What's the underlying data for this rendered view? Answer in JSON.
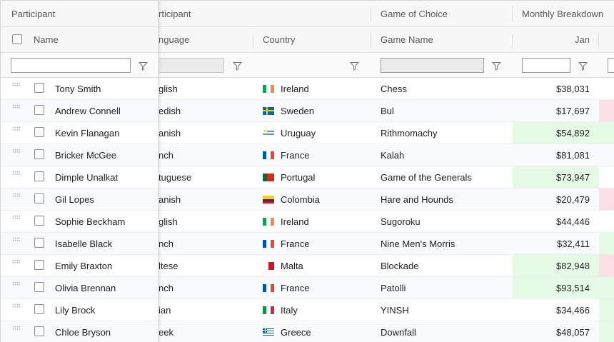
{
  "header_groups": {
    "participant": "Participant",
    "participant_scrolled": "rticipant",
    "game_of_choice": "Game of Choice",
    "monthly_breakdown": "Monthly Breakdown"
  },
  "columns": {
    "name": "Name",
    "language": "nguage",
    "country": "Country",
    "game_name": "Game Name",
    "jan": "Jan"
  },
  "rows": [
    {
      "name": "Tony Smith",
      "language": "glish",
      "country": "Ireland",
      "flag": "ireland-flag-icon",
      "game": "Chess",
      "jan": "$38,031",
      "jan_hl": "",
      "next_hl": ""
    },
    {
      "name": "Andrew Connell",
      "language": "edish",
      "country": "Sweden",
      "flag": "sweden-flag-icon",
      "game": "Bul",
      "jan": "$17,697",
      "jan_hl": "",
      "next_hl": "pink"
    },
    {
      "name": "Kevin Flanagan",
      "language": "anish",
      "country": "Uruguay",
      "flag": "uruguay-flag-icon",
      "game": "Rithmomachy",
      "jan": "$54,892",
      "jan_hl": "green",
      "next_hl": "green"
    },
    {
      "name": "Bricker McGee",
      "language": "nch",
      "country": "France",
      "flag": "france-flag-icon",
      "game": "Kalah",
      "jan": "$81,081",
      "jan_hl": "",
      "next_hl": ""
    },
    {
      "name": "Dimple Unalkat",
      "language": "tuguese",
      "country": "Portugal",
      "flag": "portugal-flag-icon",
      "game": "Game of the Generals",
      "jan": "$73,947",
      "jan_hl": "green",
      "next_hl": ""
    },
    {
      "name": "Gil Lopes",
      "language": "anish",
      "country": "Colombia",
      "flag": "colombia-flag-icon",
      "game": "Hare and Hounds",
      "jan": "$20,479",
      "jan_hl": "",
      "next_hl": "pink"
    },
    {
      "name": "Sophie Beckham",
      "language": "glish",
      "country": "Ireland",
      "flag": "ireland-flag-icon",
      "game": "Sugoroku",
      "jan": "$44,446",
      "jan_hl": "",
      "next_hl": ""
    },
    {
      "name": "Isabelle Black",
      "language": "nch",
      "country": "France",
      "flag": "france-flag-icon",
      "game": "Nine Men's Morris",
      "jan": "$32,411",
      "jan_hl": "",
      "next_hl": "green"
    },
    {
      "name": "Emily Braxton",
      "language": "ltese",
      "country": "Malta",
      "flag": "malta-flag-icon",
      "game": "Blockade",
      "jan": "$82,948",
      "jan_hl": "green",
      "next_hl": "pink"
    },
    {
      "name": "Olivia Brennan",
      "language": "nch",
      "country": "France",
      "flag": "france-flag-icon",
      "game": "Patolli",
      "jan": "$93,514",
      "jan_hl": "green",
      "next_hl": "green"
    },
    {
      "name": "Lily Brock",
      "language": "ian",
      "country": "Italy",
      "flag": "italy-flag-icon",
      "game": "YINSH",
      "jan": "$34,466",
      "jan_hl": "",
      "next_hl": "green"
    },
    {
      "name": "Chloe Bryson",
      "language": "eek",
      "country": "Greece",
      "flag": "greece-flag-icon",
      "game": "Downfall",
      "jan": "$48,057",
      "jan_hl": "",
      "next_hl": "green"
    }
  ],
  "colors": {
    "highlight_green": "#e6fbe6",
    "highlight_pink": "#fde0e6",
    "header_bg": "#f7f7f7",
    "row_alt_bg": "#f8fafd"
  },
  "icons": {
    "filter": "funnel-icon",
    "drag": "drag-handle-icon"
  }
}
